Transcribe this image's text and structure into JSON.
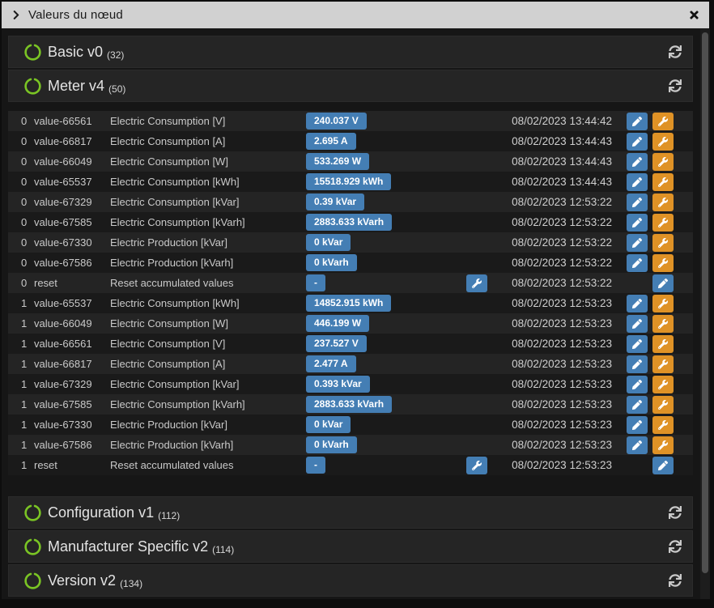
{
  "modal": {
    "title": "Valeurs du nœud"
  },
  "sections": {
    "basic": {
      "label": "Basic v0",
      "count": "(32)"
    },
    "meter": {
      "label": "Meter v4",
      "count": "(50)"
    },
    "configuration": {
      "label": "Configuration v1",
      "count": "(112)"
    },
    "manufacturer": {
      "label": "Manufacturer Specific v2",
      "count": "(114)"
    },
    "version": {
      "label": "Version v2",
      "count": "(134)"
    }
  },
  "meter_values": [
    {
      "index": "0",
      "name": "value-66561",
      "description": "Electric Consumption [V]",
      "value": "240.037 V",
      "timestamp": "08/02/2023 13:44:42",
      "kind": "value"
    },
    {
      "index": "0",
      "name": "value-66817",
      "description": "Electric Consumption [A]",
      "value": "2.695 A",
      "timestamp": "08/02/2023 13:44:43",
      "kind": "value"
    },
    {
      "index": "0",
      "name": "value-66049",
      "description": "Electric Consumption [W]",
      "value": "533.269 W",
      "timestamp": "08/02/2023 13:44:43",
      "kind": "value"
    },
    {
      "index": "0",
      "name": "value-65537",
      "description": "Electric Consumption [kWh]",
      "value": "15518.929 kWh",
      "timestamp": "08/02/2023 13:44:43",
      "kind": "value"
    },
    {
      "index": "0",
      "name": "value-67329",
      "description": "Electric Consumption [kVar]",
      "value": "0.39 kVar",
      "timestamp": "08/02/2023 12:53:22",
      "kind": "value"
    },
    {
      "index": "0",
      "name": "value-67585",
      "description": "Electric Consumption [kVarh]",
      "value": "2883.633 kVarh",
      "timestamp": "08/02/2023 12:53:22",
      "kind": "value"
    },
    {
      "index": "0",
      "name": "value-67330",
      "description": "Electric Production [kVar]",
      "value": "0 kVar",
      "timestamp": "08/02/2023 12:53:22",
      "kind": "value"
    },
    {
      "index": "0",
      "name": "value-67586",
      "description": "Electric Production [kVarh]",
      "value": "0 kVarh",
      "timestamp": "08/02/2023 12:53:22",
      "kind": "value"
    },
    {
      "index": "0",
      "name": "reset",
      "description": "Reset accumulated values",
      "value": "-",
      "timestamp": "08/02/2023 12:53:22",
      "kind": "reset"
    },
    {
      "index": "1",
      "name": "value-65537",
      "description": "Electric Consumption [kWh]",
      "value": "14852.915 kWh",
      "timestamp": "08/02/2023 12:53:23",
      "kind": "value"
    },
    {
      "index": "1",
      "name": "value-66049",
      "description": "Electric Consumption [W]",
      "value": "446.199 W",
      "timestamp": "08/02/2023 12:53:23",
      "kind": "value"
    },
    {
      "index": "1",
      "name": "value-66561",
      "description": "Electric Consumption [V]",
      "value": "237.527 V",
      "timestamp": "08/02/2023 12:53:23",
      "kind": "value"
    },
    {
      "index": "1",
      "name": "value-66817",
      "description": "Electric Consumption [A]",
      "value": "2.477 A",
      "timestamp": "08/02/2023 12:53:23",
      "kind": "value"
    },
    {
      "index": "1",
      "name": "value-67329",
      "description": "Electric Consumption [kVar]",
      "value": "0.393 kVar",
      "timestamp": "08/02/2023 12:53:23",
      "kind": "value"
    },
    {
      "index": "1",
      "name": "value-67585",
      "description": "Electric Consumption [kVarh]",
      "value": "2883.633 kVarh",
      "timestamp": "08/02/2023 12:53:23",
      "kind": "value"
    },
    {
      "index": "1",
      "name": "value-67330",
      "description": "Electric Production [kVar]",
      "value": "0 kVar",
      "timestamp": "08/02/2023 12:53:23",
      "kind": "value"
    },
    {
      "index": "1",
      "name": "value-67586",
      "description": "Electric Production [kVarh]",
      "value": "0 kVarh",
      "timestamp": "08/02/2023 12:53:23",
      "kind": "value"
    },
    {
      "index": "1",
      "name": "reset",
      "description": "Reset accumulated values",
      "value": "-",
      "timestamp": "08/02/2023 12:53:23",
      "kind": "reset"
    }
  ],
  "icons": {
    "chevron": "chevron-right",
    "close": "close",
    "section_status": "circle-notch",
    "refresh": "refresh",
    "edit": "pencil",
    "advanced": "wrench"
  },
  "colors": {
    "accent_blue": "#447eb4",
    "accent_orange": "#df9226",
    "accent_green": "#7ac424",
    "titlebar_bg": "#d1d1d1"
  }
}
